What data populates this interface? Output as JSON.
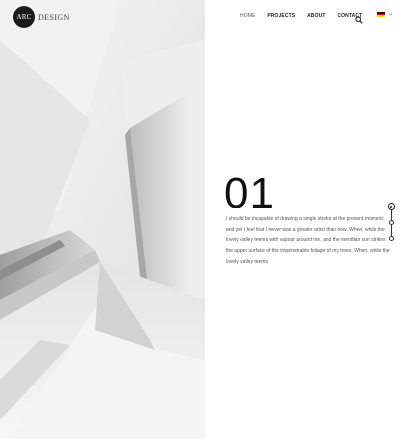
{
  "brand": {
    "mark": "ARC",
    "name": "DESIGN"
  },
  "nav": {
    "items": [
      {
        "label": "HOME"
      },
      {
        "label": "PROJECTS"
      },
      {
        "label": "ABOUT"
      },
      {
        "label": "CONTACT"
      }
    ]
  },
  "header": {
    "search_icon": "search-icon",
    "language_icon": "german-flag-icon",
    "language_dropdown_icon": "chevron-down-icon"
  },
  "slide": {
    "number": "01",
    "text": "I should be incapable of drawing a single stroke at the present moment; and yet I feel that I never was a greater artist than now. When, while the lovely valley teems with vapour around me, and the meridian sun strikes the upper surface of the impenetrable foliage of my trees. When, while the lovely valley teems.",
    "count": 3,
    "active_index": 0
  },
  "colors": {
    "flag_black": "#1a1a1a",
    "flag_red": "#dd0000",
    "flag_gold": "#ffce00"
  }
}
